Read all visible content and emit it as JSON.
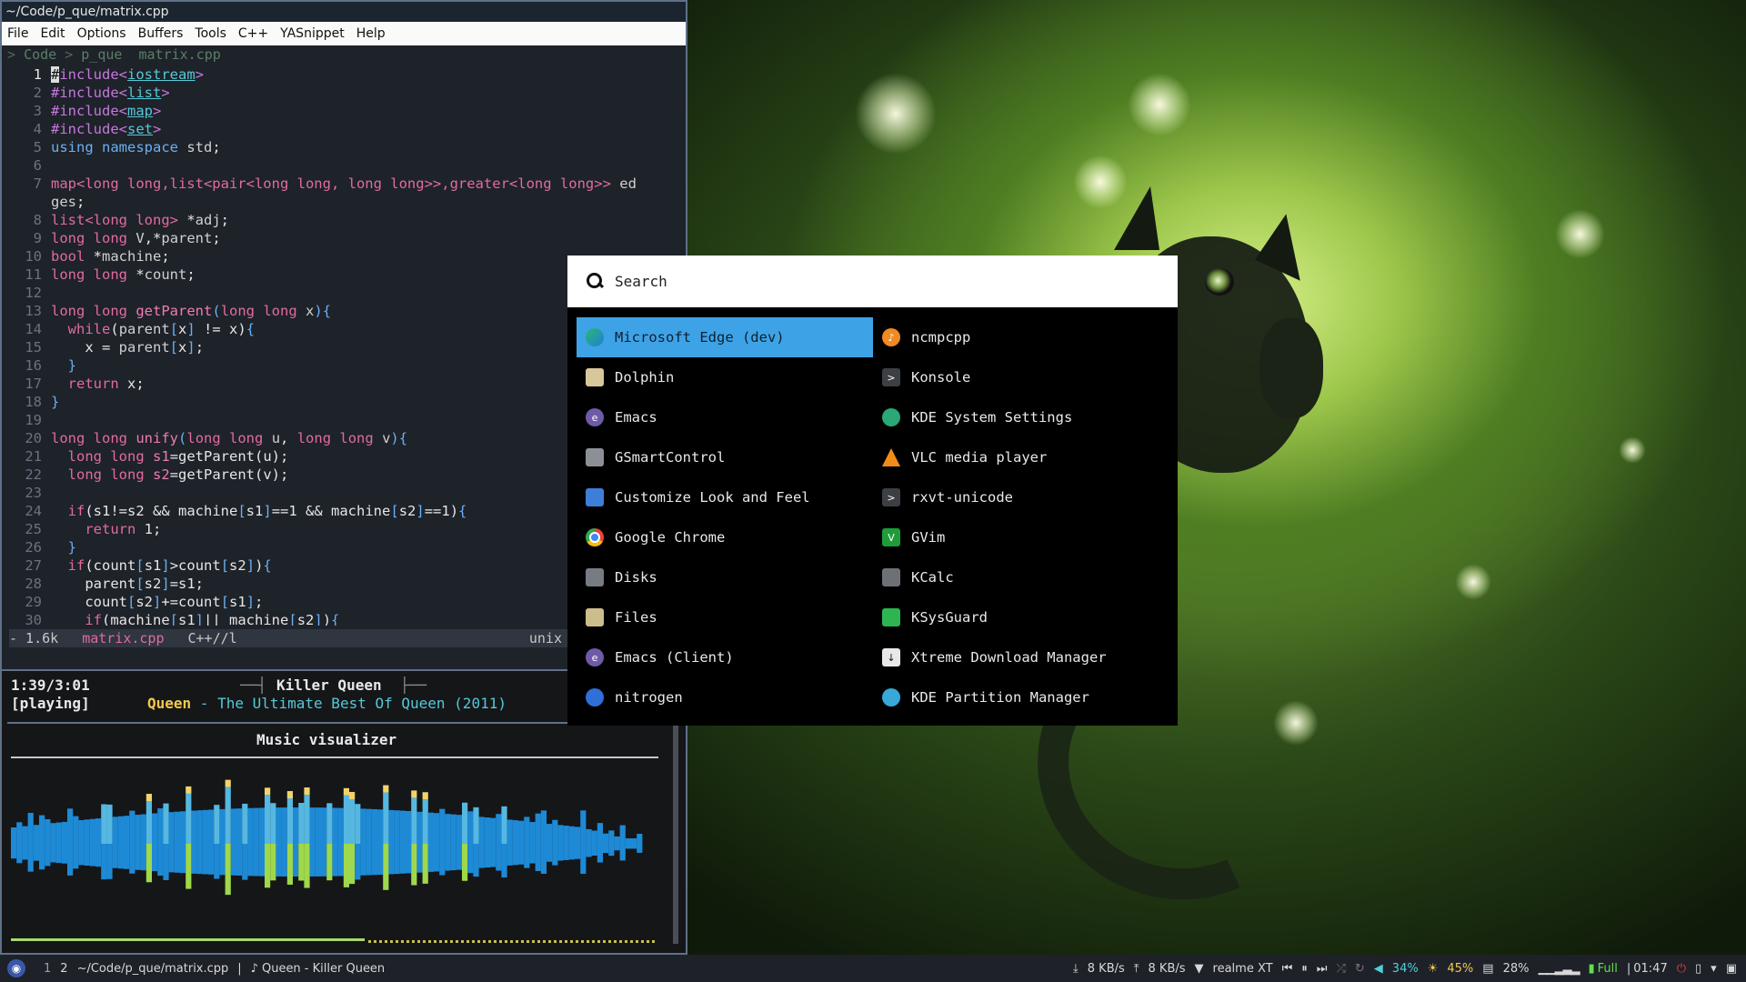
{
  "emacs": {
    "title": "~/Code/p_que/matrix.cpp",
    "menu": [
      "File",
      "Edit",
      "Options",
      "Buffers",
      "Tools",
      "C++",
      "YASnippet",
      "Help"
    ],
    "breadcrumb": [
      "Code",
      "p_que",
      "matrix.cpp"
    ],
    "line_numbers": [
      "1",
      "2",
      "3",
      "4",
      "5",
      "6",
      "7",
      "",
      "8",
      "9",
      "10",
      "11",
      "12",
      "13",
      "14",
      "15",
      "16",
      "17",
      "18",
      "19",
      "20",
      "21",
      "22",
      "23",
      "24",
      "25",
      "26",
      "27",
      "28",
      "29",
      "30"
    ],
    "modeline": {
      "size": "- 1.6k",
      "file": "matrix.cpp",
      "mode": "C++//l",
      "eol": "unix"
    }
  },
  "ncmpcpp": {
    "time": "1:39/3:01",
    "state": "[playing]",
    "song_title": "Killer Queen",
    "artist": "Queen",
    "separator": " - ",
    "album": "The Ultimate Best Of Queen",
    "year": "(2011)",
    "visualizer_title": "Music visualizer",
    "progress": 0.547
  },
  "launcher": {
    "search_placeholder": "Search",
    "left_column": [
      {
        "label": "Microsoft Edge (dev)",
        "icon": "edge-icon",
        "selected": true
      },
      {
        "label": "Dolphin",
        "icon": "dolphin-icon"
      },
      {
        "label": "Emacs",
        "icon": "emacs-icon"
      },
      {
        "label": "GSmartControl",
        "icon": "gsmartcontrol-icon"
      },
      {
        "label": "Customize Look and Feel",
        "icon": "look-and-feel-icon"
      },
      {
        "label": "Google Chrome",
        "icon": "chrome-icon"
      },
      {
        "label": "Disks",
        "icon": "disks-icon"
      },
      {
        "label": "Files",
        "icon": "files-icon"
      },
      {
        "label": "Emacs (Client)",
        "icon": "emacs-client-icon"
      },
      {
        "label": "nitrogen",
        "icon": "nitrogen-icon"
      }
    ],
    "right_column": [
      {
        "label": "ncmpcpp",
        "icon": "ncmpcpp-icon"
      },
      {
        "label": "Konsole",
        "icon": "konsole-icon"
      },
      {
        "label": "KDE System Settings",
        "icon": "kde-settings-icon"
      },
      {
        "label": "VLC media player",
        "icon": "vlc-icon"
      },
      {
        "label": "rxvt-unicode",
        "icon": "terminal-icon"
      },
      {
        "label": "GVim",
        "icon": "gvim-icon"
      },
      {
        "label": "KCalc",
        "icon": "kcalc-icon"
      },
      {
        "label": "KSysGuard",
        "icon": "ksysguard-icon"
      },
      {
        "label": "Xtreme Download Manager",
        "icon": "download-manager-icon"
      },
      {
        "label": "KDE Partition Manager",
        "icon": "partition-manager-icon"
      }
    ]
  },
  "panel": {
    "workspaces": [
      "1",
      "2"
    ],
    "window_title": "~/Code/p_que/matrix.cpp",
    "now_playing": "Queen - Killer Queen",
    "download": "8 KB/s",
    "upload": "8 KB/s",
    "network": "realme XT",
    "volume": "34%",
    "brightness": "45%",
    "cpu": "28%",
    "battery": "Full",
    "clock": "01:47"
  },
  "colors": {
    "launcher_selected": "#3da3e6",
    "emacs_keyword": "#e06c9f",
    "ncmpcpp_artist": "#f2c94c",
    "ncmpcpp_album": "#56c8d8"
  }
}
